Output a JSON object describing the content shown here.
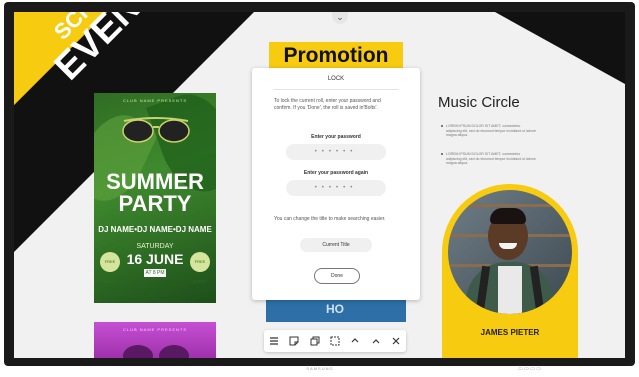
{
  "banner": {
    "line1": "SCHOOL",
    "line2": "EVENT!"
  },
  "poster": {
    "presents": "CLUB NAME PRESENTS",
    "title_line1": "SUMMER",
    "title_line2": "PARTY",
    "djs": "DJ NAME•DJ NAME•DJ NAME",
    "day": "SATURDAY",
    "date": "16 JUNE",
    "time": "AT 8 PM",
    "badge_left": "FREE DRINKS",
    "badge_right": "FREE ENTRY"
  },
  "poster2": {
    "presents": "CLUB NAME PRESENTS"
  },
  "promotion": {
    "title": "Promotion"
  },
  "lock_dialog": {
    "title": "LOCK",
    "description": "To lock the current roll, enter your password and confirm. If you 'Done', the roll is saved in'Bolts'.",
    "password_label": "Enter your password",
    "password_again_label": "Enter your password again",
    "password_mask": "••••••",
    "hint": "You can change the title to make searching easier.",
    "title_button": "Current Title",
    "done_button": "Done"
  },
  "behind_text": "HO",
  "music": {
    "title": "Music Circle",
    "bullets": [
      "LOREM IPSUM DOLOR SIT AMET, consectetur adipiscing elit, sed do eiusmod tempor incididunt ut labore magna aliqua.",
      "LOREM IPSUM DOLOR SIT AMET, consectetur adipiscing elit, sed do eiusmod tempor incididunt ut labore magna aliqua."
    ],
    "person_name": "JAMES PIETER"
  },
  "display": {
    "brand": "SAMSUNG"
  },
  "toolbar": {
    "icons": [
      "menu-icon",
      "sticky-note-icon",
      "copy-icon",
      "select-icon",
      "undo-icon",
      "redo-icon",
      "close-icon"
    ]
  },
  "colors": {
    "accent_yellow": "#f7cb0f",
    "poster_green": "#3f8a2e",
    "poster_purple": "#c64fd3"
  }
}
